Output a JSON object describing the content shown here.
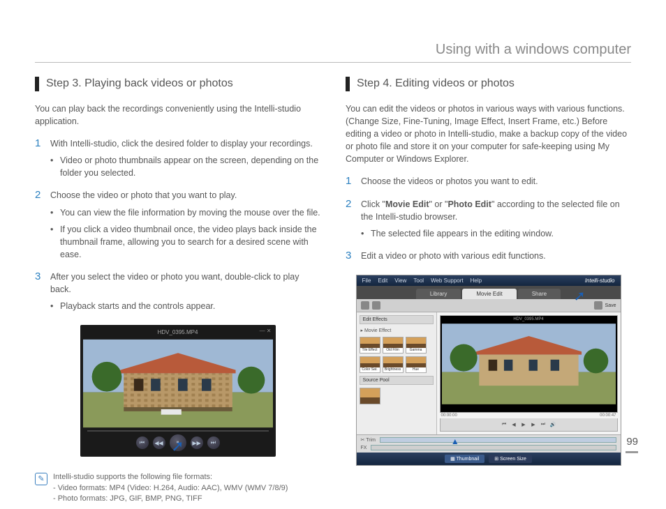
{
  "header": {
    "title": "Using with a windows computer"
  },
  "left": {
    "heading": "Step 3. Playing back videos or photos",
    "intro": "You can play back the recordings conveniently using the Intelli-studio application.",
    "steps": [
      {
        "text": "With Intelli-studio, click the desired folder to display your recordings.",
        "bullets": [
          "Video or photo thumbnails appear on the screen, depending on the folder you selected."
        ]
      },
      {
        "text": "Choose the video or photo that you want to play.",
        "bullets": [
          "You can view the file information by moving the mouse over the file.",
          "If you click a video thumbnail once, the video plays back inside the thumbnail frame, allowing you to search for a desired scene with ease."
        ]
      },
      {
        "text": "After you select the video or photo you want, double-click to play back.",
        "bullets": [
          "Playback starts and the controls appear."
        ]
      }
    ],
    "player": {
      "filename": "HDV_0395.MP4"
    },
    "note": {
      "line1": "Intelli-studio supports the following file formats:",
      "line2": "- Video formats: MP4 (Video: H.264, Audio: AAC), WMV (WMV 7/8/9)",
      "line3": "- Photo formats: JPG, GIF, BMP, PNG, TIFF"
    }
  },
  "right": {
    "heading": "Step 4. Editing videos or photos",
    "intro": "You can edit the videos or photos in various ways with various functions. (Change Size, Fine-Tuning, Image Effect, Insert Frame, etc.) Before editing a video or photo in Intelli-studio, make a backup copy of the video or photo file and store it on your computer for safe-keeping using My Computer or Windows Explorer.",
    "steps": [
      {
        "text": "Choose the videos or photos you want to edit.",
        "bullets": []
      },
      {
        "pre": "Click \"",
        "b1": "Movie Edit",
        "mid": "\" or \"",
        "b2": "Photo Edit",
        "post": "\" according to the selected file on the Intelli-studio browser.",
        "bullets": [
          "The selected file appears in the editing window."
        ]
      },
      {
        "text": "Edit a video or photo with various edit functions.",
        "bullets": []
      }
    ],
    "editor": {
      "menu": [
        "File",
        "Edit",
        "View",
        "Tool",
        "Web Support",
        "Help"
      ],
      "brand": "Intelli-studio",
      "tabs": [
        "Library",
        "Movie Edit",
        "Share"
      ],
      "toolbar_save": "Save",
      "panel_effects": "Edit Effects",
      "panel_movie": "Movie Effect",
      "effect_labels": [
        "Tile Effect",
        "Old Film",
        "Gamma",
        "Color Sat.",
        "Brightness",
        "Hue"
      ],
      "panel_source": "Source Pool",
      "preview_file": "HDV_0395.MP4",
      "time_left": "00:00:00",
      "time_right": "00:00:47",
      "trim": "Trim",
      "footer": [
        "Thumbnail",
        "Screen Size"
      ]
    }
  },
  "page_number": "99"
}
